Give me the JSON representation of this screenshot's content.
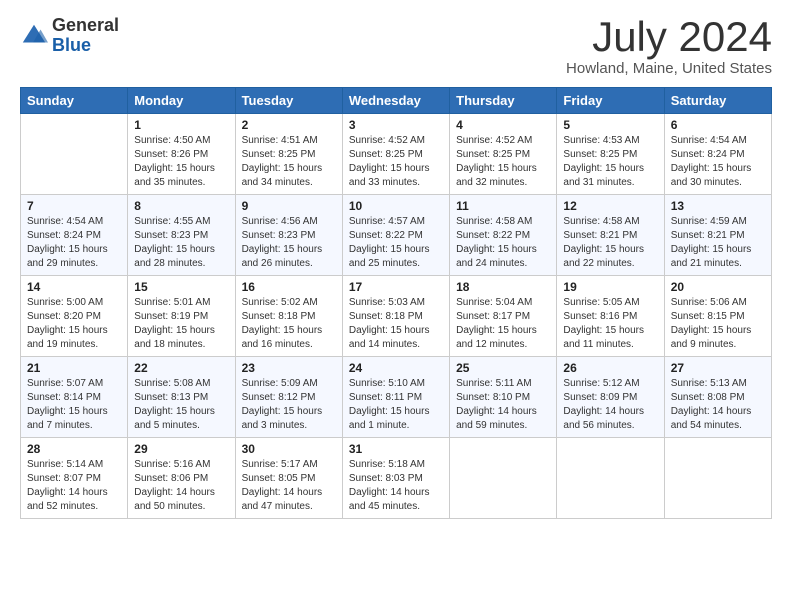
{
  "header": {
    "logo_line1": "General",
    "logo_line2": "Blue",
    "title": "July 2024",
    "subtitle": "Howland, Maine, United States"
  },
  "weekdays": [
    "Sunday",
    "Monday",
    "Tuesday",
    "Wednesday",
    "Thursday",
    "Friday",
    "Saturday"
  ],
  "weeks": [
    [
      {
        "day": "",
        "info": ""
      },
      {
        "day": "1",
        "info": "Sunrise: 4:50 AM\nSunset: 8:26 PM\nDaylight: 15 hours\nand 35 minutes."
      },
      {
        "day": "2",
        "info": "Sunrise: 4:51 AM\nSunset: 8:25 PM\nDaylight: 15 hours\nand 34 minutes."
      },
      {
        "day": "3",
        "info": "Sunrise: 4:52 AM\nSunset: 8:25 PM\nDaylight: 15 hours\nand 33 minutes."
      },
      {
        "day": "4",
        "info": "Sunrise: 4:52 AM\nSunset: 8:25 PM\nDaylight: 15 hours\nand 32 minutes."
      },
      {
        "day": "5",
        "info": "Sunrise: 4:53 AM\nSunset: 8:25 PM\nDaylight: 15 hours\nand 31 minutes."
      },
      {
        "day": "6",
        "info": "Sunrise: 4:54 AM\nSunset: 8:24 PM\nDaylight: 15 hours\nand 30 minutes."
      }
    ],
    [
      {
        "day": "7",
        "info": "Sunrise: 4:54 AM\nSunset: 8:24 PM\nDaylight: 15 hours\nand 29 minutes."
      },
      {
        "day": "8",
        "info": "Sunrise: 4:55 AM\nSunset: 8:23 PM\nDaylight: 15 hours\nand 28 minutes."
      },
      {
        "day": "9",
        "info": "Sunrise: 4:56 AM\nSunset: 8:23 PM\nDaylight: 15 hours\nand 26 minutes."
      },
      {
        "day": "10",
        "info": "Sunrise: 4:57 AM\nSunset: 8:22 PM\nDaylight: 15 hours\nand 25 minutes."
      },
      {
        "day": "11",
        "info": "Sunrise: 4:58 AM\nSunset: 8:22 PM\nDaylight: 15 hours\nand 24 minutes."
      },
      {
        "day": "12",
        "info": "Sunrise: 4:58 AM\nSunset: 8:21 PM\nDaylight: 15 hours\nand 22 minutes."
      },
      {
        "day": "13",
        "info": "Sunrise: 4:59 AM\nSunset: 8:21 PM\nDaylight: 15 hours\nand 21 minutes."
      }
    ],
    [
      {
        "day": "14",
        "info": "Sunrise: 5:00 AM\nSunset: 8:20 PM\nDaylight: 15 hours\nand 19 minutes."
      },
      {
        "day": "15",
        "info": "Sunrise: 5:01 AM\nSunset: 8:19 PM\nDaylight: 15 hours\nand 18 minutes."
      },
      {
        "day": "16",
        "info": "Sunrise: 5:02 AM\nSunset: 8:18 PM\nDaylight: 15 hours\nand 16 minutes."
      },
      {
        "day": "17",
        "info": "Sunrise: 5:03 AM\nSunset: 8:18 PM\nDaylight: 15 hours\nand 14 minutes."
      },
      {
        "day": "18",
        "info": "Sunrise: 5:04 AM\nSunset: 8:17 PM\nDaylight: 15 hours\nand 12 minutes."
      },
      {
        "day": "19",
        "info": "Sunrise: 5:05 AM\nSunset: 8:16 PM\nDaylight: 15 hours\nand 11 minutes."
      },
      {
        "day": "20",
        "info": "Sunrise: 5:06 AM\nSunset: 8:15 PM\nDaylight: 15 hours\nand 9 minutes."
      }
    ],
    [
      {
        "day": "21",
        "info": "Sunrise: 5:07 AM\nSunset: 8:14 PM\nDaylight: 15 hours\nand 7 minutes."
      },
      {
        "day": "22",
        "info": "Sunrise: 5:08 AM\nSunset: 8:13 PM\nDaylight: 15 hours\nand 5 minutes."
      },
      {
        "day": "23",
        "info": "Sunrise: 5:09 AM\nSunset: 8:12 PM\nDaylight: 15 hours\nand 3 minutes."
      },
      {
        "day": "24",
        "info": "Sunrise: 5:10 AM\nSunset: 8:11 PM\nDaylight: 15 hours\nand 1 minute."
      },
      {
        "day": "25",
        "info": "Sunrise: 5:11 AM\nSunset: 8:10 PM\nDaylight: 14 hours\nand 59 minutes."
      },
      {
        "day": "26",
        "info": "Sunrise: 5:12 AM\nSunset: 8:09 PM\nDaylight: 14 hours\nand 56 minutes."
      },
      {
        "day": "27",
        "info": "Sunrise: 5:13 AM\nSunset: 8:08 PM\nDaylight: 14 hours\nand 54 minutes."
      }
    ],
    [
      {
        "day": "28",
        "info": "Sunrise: 5:14 AM\nSunset: 8:07 PM\nDaylight: 14 hours\nand 52 minutes."
      },
      {
        "day": "29",
        "info": "Sunrise: 5:16 AM\nSunset: 8:06 PM\nDaylight: 14 hours\nand 50 minutes."
      },
      {
        "day": "30",
        "info": "Sunrise: 5:17 AM\nSunset: 8:05 PM\nDaylight: 14 hours\nand 47 minutes."
      },
      {
        "day": "31",
        "info": "Sunrise: 5:18 AM\nSunset: 8:03 PM\nDaylight: 14 hours\nand 45 minutes."
      },
      {
        "day": "",
        "info": ""
      },
      {
        "day": "",
        "info": ""
      },
      {
        "day": "",
        "info": ""
      }
    ]
  ]
}
